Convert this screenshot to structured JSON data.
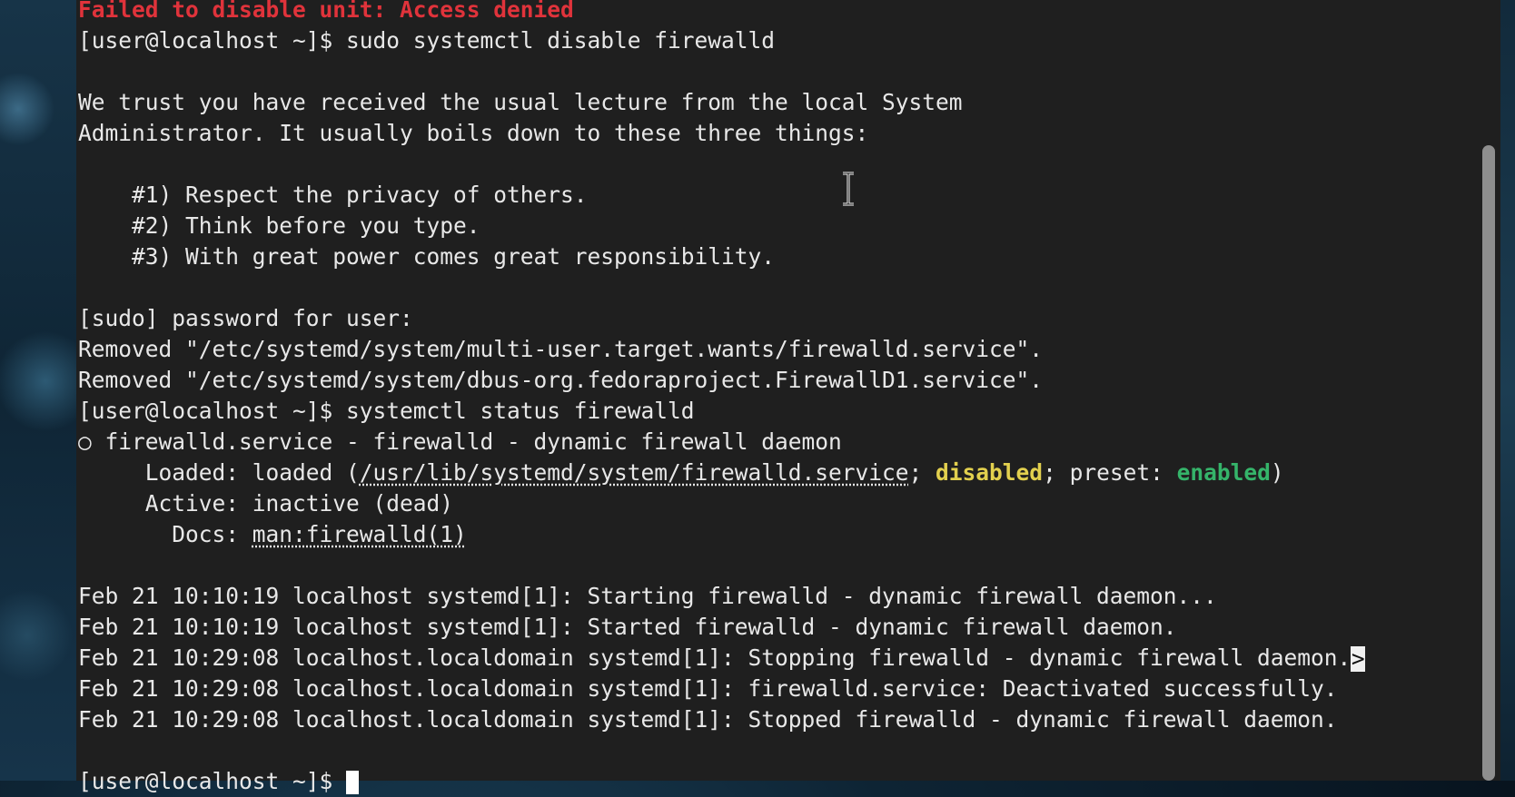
{
  "terminal": {
    "lines": [
      {
        "text": "Failed to disable unit: Access denied",
        "style": "red"
      },
      {
        "text": "[user@localhost ~]$ sudo systemctl disable firewalld"
      },
      {
        "text": ""
      },
      {
        "text": "We trust you have received the usual lecture from the local System"
      },
      {
        "text": "Administrator. It usually boils down to these three things:"
      },
      {
        "text": ""
      },
      {
        "text": "    #1) Respect the privacy of others."
      },
      {
        "text": "    #2) Think before you type."
      },
      {
        "text": "    #3) With great power comes great responsibility."
      },
      {
        "text": ""
      },
      {
        "text": "[sudo] password for user:"
      },
      {
        "text": "Removed \"/etc/systemd/system/multi-user.target.wants/firewalld.service\"."
      },
      {
        "text": "Removed \"/etc/systemd/system/dbus-org.fedoraproject.FirewallD1.service\"."
      },
      {
        "text": "[user@localhost ~]$ systemctl status firewalld"
      },
      {
        "text": "○ firewalld.service - firewalld - dynamic firewall daemon"
      }
    ],
    "loaded_line": {
      "prefix": "     Loaded: loaded (",
      "path": "/usr/lib/systemd/system/firewalld.service",
      "sep1": "; ",
      "state": "disabled",
      "sep2": "; preset: ",
      "preset": "enabled",
      "suffix": ")",
      "state_color": "#e2d04e",
      "preset_color": "#35b46a"
    },
    "active_line": "     Active: inactive (dead)",
    "docs_line": {
      "prefix": "       Docs: ",
      "link": "man:firewalld(1)"
    },
    "log_lines": [
      "Feb 21 10:10:19 localhost systemd[1]: Starting firewalld - dynamic firewall daemon...",
      "Feb 21 10:10:19 localhost systemd[1]: Started firewalld - dynamic firewall daemon.",
      "Feb 21 10:29:08 localhost.localdomain systemd[1]: Stopping firewalld - dynamic firewall daemon.",
      "Feb 21 10:29:08 localhost.localdomain systemd[1]: firewalld.service: Deactivated successfully.",
      "Feb 21 10:29:08 localhost.localdomain systemd[1]: Stopped firewalld - dynamic firewall daemon."
    ],
    "truncation_marker": ">",
    "prompt": "[user@localhost ~]$ ",
    "colors": {
      "background": "#1f1f1f",
      "foreground": "#e8e8e8",
      "error": "#e0333b"
    }
  }
}
